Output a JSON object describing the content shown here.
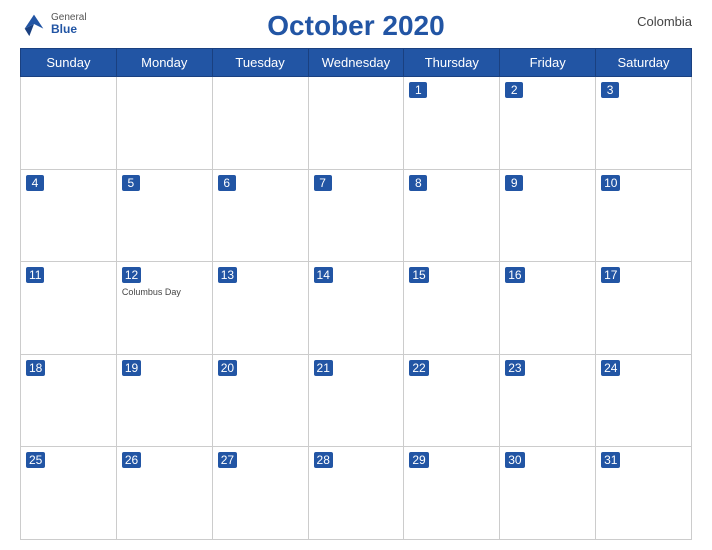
{
  "header": {
    "title": "October 2020",
    "country": "Colombia",
    "logo": {
      "general": "General",
      "blue": "Blue"
    }
  },
  "weekdays": [
    "Sunday",
    "Monday",
    "Tuesday",
    "Wednesday",
    "Thursday",
    "Friday",
    "Saturday"
  ],
  "weeks": [
    [
      {
        "day": "",
        "event": ""
      },
      {
        "day": "",
        "event": ""
      },
      {
        "day": "",
        "event": ""
      },
      {
        "day": "",
        "event": ""
      },
      {
        "day": "1",
        "event": ""
      },
      {
        "day": "2",
        "event": ""
      },
      {
        "day": "3",
        "event": ""
      }
    ],
    [
      {
        "day": "4",
        "event": ""
      },
      {
        "day": "5",
        "event": ""
      },
      {
        "day": "6",
        "event": ""
      },
      {
        "day": "7",
        "event": ""
      },
      {
        "day": "8",
        "event": ""
      },
      {
        "day": "9",
        "event": ""
      },
      {
        "day": "10",
        "event": ""
      }
    ],
    [
      {
        "day": "11",
        "event": ""
      },
      {
        "day": "12",
        "event": "Columbus Day"
      },
      {
        "day": "13",
        "event": ""
      },
      {
        "day": "14",
        "event": ""
      },
      {
        "day": "15",
        "event": ""
      },
      {
        "day": "16",
        "event": ""
      },
      {
        "day": "17",
        "event": ""
      }
    ],
    [
      {
        "day": "18",
        "event": ""
      },
      {
        "day": "19",
        "event": ""
      },
      {
        "day": "20",
        "event": ""
      },
      {
        "day": "21",
        "event": ""
      },
      {
        "day": "22",
        "event": ""
      },
      {
        "day": "23",
        "event": ""
      },
      {
        "day": "24",
        "event": ""
      }
    ],
    [
      {
        "day": "25",
        "event": ""
      },
      {
        "day": "26",
        "event": ""
      },
      {
        "day": "27",
        "event": ""
      },
      {
        "day": "28",
        "event": ""
      },
      {
        "day": "29",
        "event": ""
      },
      {
        "day": "30",
        "event": ""
      },
      {
        "day": "31",
        "event": ""
      }
    ]
  ]
}
